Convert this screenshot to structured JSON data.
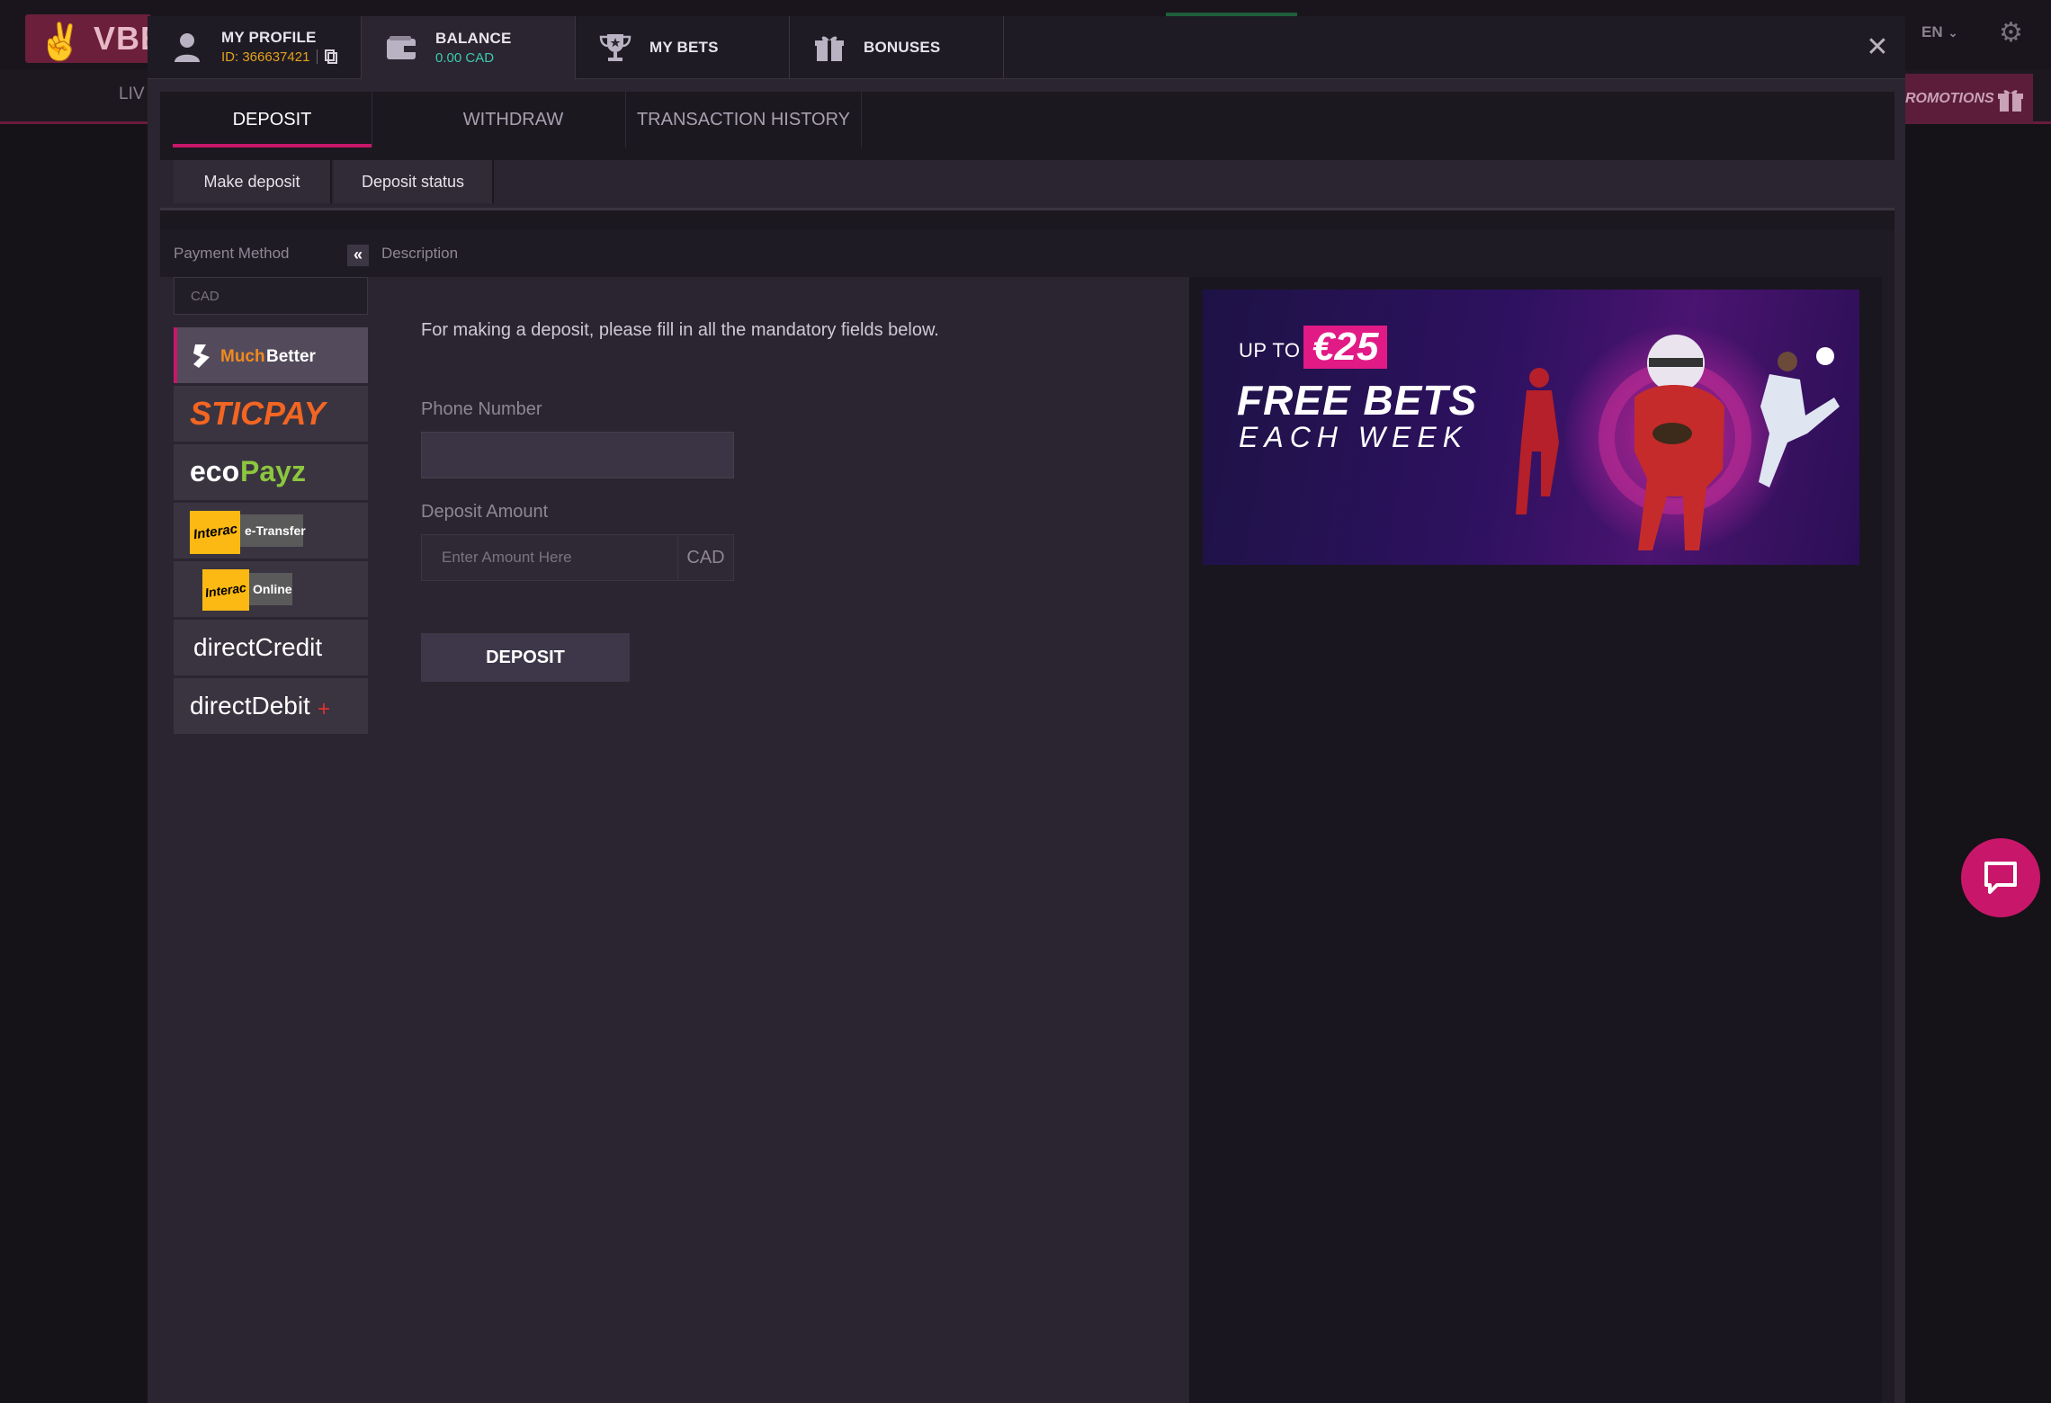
{
  "background": {
    "logo_text": "VBE",
    "nav_live": "LIV",
    "lang": "EN",
    "promotions": "ROMOTIONS"
  },
  "profile_tab": {
    "title": "MY PROFILE",
    "id_label": "ID: 366637421"
  },
  "balance_tab": {
    "title": "BALANCE",
    "amount": "0.00 CAD"
  },
  "bets_tab": {
    "title": "MY BETS"
  },
  "bonuses_tab": {
    "title": "BONUSES"
  },
  "sub_tabs": [
    "DEPOSIT",
    "WITHDRAW",
    "TRANSACTION HISTORY"
  ],
  "deposit_tabs": [
    "Make deposit",
    "Deposit status"
  ],
  "panel": {
    "payment_method_label": "Payment Method",
    "description_label": "Description",
    "currency_filter": "CAD"
  },
  "payment_methods": [
    {
      "name": "MuchBetter",
      "selected": true
    },
    {
      "name": "STICPAY"
    },
    {
      "name": "ecoPayz"
    },
    {
      "name": "Interac e-Transfer",
      "logo_word": "Interac",
      "logo_suffix": "e-Transfer"
    },
    {
      "name": "Interac Online",
      "logo_word": "Interac",
      "logo_suffix": "Online"
    },
    {
      "name": "directCredit"
    },
    {
      "name": "directDebit+"
    }
  ],
  "form": {
    "intro": "For making a deposit, please fill in all the mandatory fields below.",
    "phone_label": "Phone Number",
    "amount_label": "Deposit Amount",
    "amount_placeholder": "Enter Amount Here",
    "amount_currency": "CAD",
    "submit_label": "DEPOSIT"
  },
  "banner": {
    "up_to": "UP TO",
    "amount": "€25",
    "line1": "FREE BETS",
    "line2": "EACH WEEK"
  },
  "colors": {
    "accent": "#c8176a",
    "id_text": "#e3a21b",
    "balance_text": "#3fc9b0"
  }
}
